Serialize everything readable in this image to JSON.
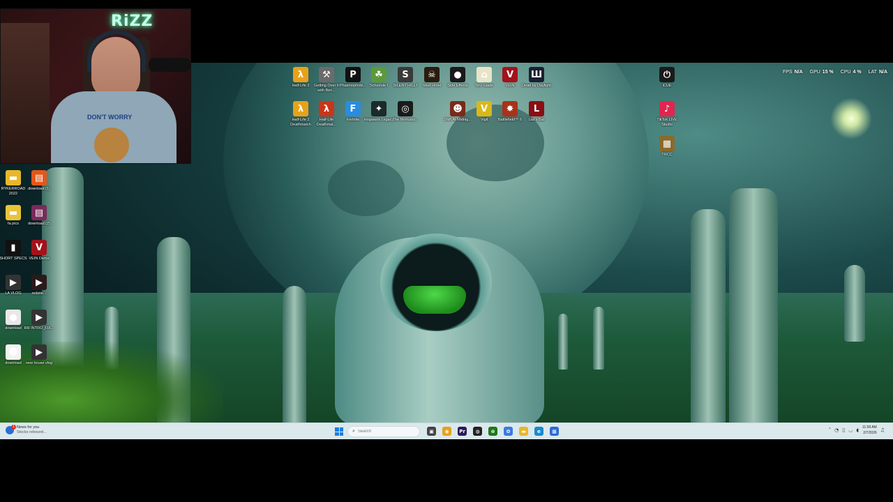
{
  "webcam": {
    "neon_text": "RiZZ",
    "shirt_text": "DON'T WORRY"
  },
  "desktop_icons_top_row": [
    {
      "label": "Half-Life 2",
      "icon": "half-life-2-icon",
      "color": "#e8a21a",
      "glyph": "λ"
    },
    {
      "label": "Getting Over It with Ben...",
      "icon": "hammer-icon",
      "color": "#6b6b6b",
      "glyph": "⚒"
    },
    {
      "label": "Phasmophobi...",
      "icon": "phasmophobia-icon",
      "color": "#111111",
      "glyph": "P"
    },
    {
      "label": "Schedule I",
      "icon": "schedule-i-icon",
      "color": "#5b9a3c",
      "glyph": "☘"
    },
    {
      "label": "SILENT HILL f",
      "icon": "silent-hill-icon",
      "color": "#3a3a3a",
      "glyph": "S"
    },
    {
      "label": "Skull Hotel",
      "icon": "skull-hotel-icon",
      "color": "#2a1c0c",
      "glyph": "☠"
    },
    {
      "label": "Side Effects",
      "icon": "side-effects-icon",
      "color": "#1a1a1a",
      "glyph": "●"
    },
    {
      "label": "Tiny Glade",
      "icon": "tiny-glade-icon",
      "color": "#e9e4c7",
      "glyph": "⌂"
    },
    {
      "label": "VEIN",
      "icon": "vein-icon",
      "color": "#a4121a",
      "glyph": "V"
    },
    {
      "label": "Dead by Daylight",
      "icon": "dead-by-daylight-icon",
      "color": "#1a2030",
      "glyph": "Ш"
    }
  ],
  "desktop_icons_second_row": [
    {
      "label": "Half-Life 2 Deathmatch",
      "icon": "half-life-2-deathmatch-icon",
      "color": "#e8a21a",
      "glyph": "λ"
    },
    {
      "label": "Half-Life Deathmat...",
      "icon": "half-life-deathmatch-icon",
      "color": "#c8361a",
      "glyph": "λ"
    },
    {
      "label": "Fortnite",
      "icon": "fortnite-icon",
      "color": "#2a8ce0",
      "glyph": "F"
    },
    {
      "label": "Hogwarts Legacy",
      "icon": "hogwarts-legacy-icon",
      "color": "#1c2a2a",
      "glyph": "✦"
    },
    {
      "label": "The Mortuary...",
      "icon": "mortuary-icon",
      "color": "#1a1a1a",
      "glyph": "◎"
    },
    {
      "label": "Shift At Midnig...",
      "icon": "shift-at-midnight-icon",
      "color": "#7a2a1a",
      "glyph": "☻"
    },
    {
      "label": "Vigil",
      "icon": "vigil-icon",
      "color": "#d8b81a",
      "glyph": "V"
    },
    {
      "label": "Battlefield™ 6",
      "icon": "battlefield-6-icon",
      "color": "#a8321a",
      "glyph": "✸"
    },
    {
      "label": "Liar's Bar",
      "icon": "liars-bar-icon",
      "color": "#8a0e12",
      "glyph": "L"
    }
  ],
  "desktop_icons_right": [
    {
      "label": "iCUE",
      "icon": "icue-icon",
      "color": "#1a1a1a",
      "glyph": "⏻"
    },
    {
      "label": "TikTok LIVE Studio",
      "icon": "tiktok-live-studio-icon",
      "color": "#e0264f",
      "glyph": "♪"
    },
    {
      "label": "TRCC",
      "icon": "trcc-icon",
      "color": "#8a6a2a",
      "glyph": "▦"
    }
  ],
  "desktop_icons_left": [
    {
      "label": "RYKERROAD 2022",
      "icon": "folder-icon",
      "color": "#e8b82a",
      "glyph": "▬"
    },
    {
      "label": "download (1)",
      "icon": "image-file-icon",
      "color": "#e2571a",
      "glyph": "▤"
    },
    {
      "label": "fa pics",
      "icon": "folder-icon",
      "color": "#e8c43a",
      "glyph": "▬"
    },
    {
      "label": "download (2)",
      "icon": "image-file-icon",
      "color": "#7a2a5a",
      "glyph": "▤"
    },
    {
      "label": "SHORT SPECS",
      "icon": "phone-image-icon",
      "color": "#111111",
      "glyph": "▮"
    },
    {
      "label": "VEIN Demo",
      "icon": "vein-demo-icon",
      "color": "#a4121a",
      "glyph": "V"
    },
    {
      "label": "LA VLOG",
      "icon": "video-file-icon",
      "color": "#333333",
      "glyph": "▶"
    },
    {
      "label": "redsite...",
      "icon": "video-file-icon",
      "color": "#2a1a1a",
      "glyph": "▶"
    },
    {
      "label": "download",
      "icon": "reddit-image-icon",
      "color": "#e8e8e8",
      "glyph": "●"
    },
    {
      "label": "RR INTRO_FIX...",
      "icon": "video-file-icon",
      "color": "#333333",
      "glyph": "▶"
    },
    {
      "label": "download",
      "icon": "image-file-icon",
      "color": "#f2f2f2",
      "glyph": "☻"
    },
    {
      "label": "new house vlog",
      "icon": "video-file-icon",
      "color": "#333333",
      "glyph": "▶"
    }
  ],
  "perf": [
    {
      "key": "FPS",
      "value": "N/A"
    },
    {
      "key": "GPU",
      "value": "15 %"
    },
    {
      "key": "CPU",
      "value": "4 %"
    },
    {
      "key": "LAT",
      "value": "N/A"
    }
  ],
  "taskbar": {
    "weather_title": "News for you",
    "weather_sub": "Stocks rebound...",
    "weather_badge": "1",
    "search_placeholder": "Search",
    "apps": [
      {
        "name": "task-view-icon",
        "color": "#444444",
        "glyph": "▣"
      },
      {
        "name": "chrome-icon",
        "color": "#e8a01a",
        "glyph": "◉"
      },
      {
        "name": "premiere-pro-icon",
        "color": "#2a1a5a",
        "glyph": "Pr"
      },
      {
        "name": "obs-icon",
        "color": "#222222",
        "glyph": "◍"
      },
      {
        "name": "xbox-icon",
        "color": "#1a7a1a",
        "glyph": "⊗"
      },
      {
        "name": "copilot-icon",
        "color": "#3a7ae0",
        "glyph": "✿"
      },
      {
        "name": "file-explorer-icon",
        "color": "#e8b82a",
        "glyph": "▬"
      },
      {
        "name": "edge-icon",
        "color": "#1a8ad0",
        "glyph": "e"
      },
      {
        "name": "store-icon",
        "color": "#2a6ad8",
        "glyph": "▦"
      }
    ],
    "clock_time": "11:58 AM",
    "clock_date": "2/7/2026"
  }
}
